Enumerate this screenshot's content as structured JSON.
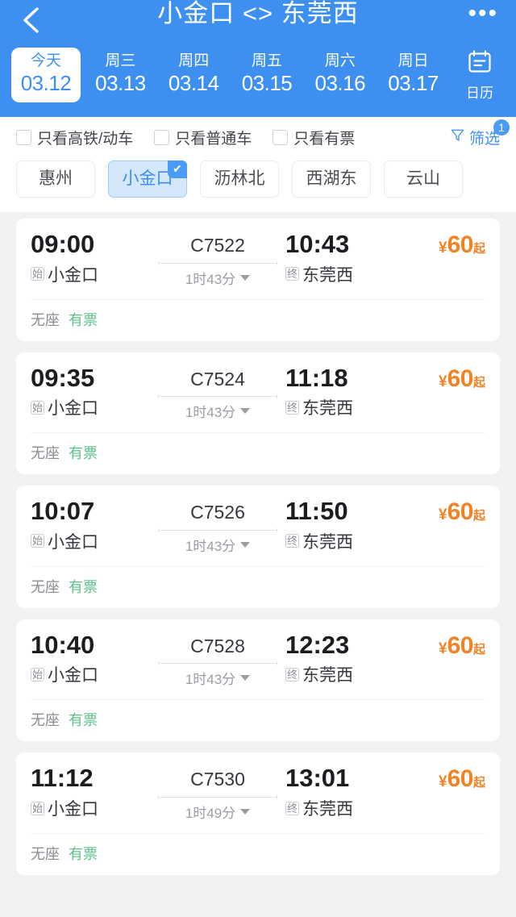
{
  "header": {
    "title": "小金口 <> 东莞西",
    "back_icon": "chevron-left-icon",
    "more_icon": "more-horizontal-icon",
    "calendar": {
      "icon": "calendar-icon",
      "label": "日历"
    },
    "dates": [
      {
        "dow": "今天",
        "date": "03.12",
        "active": true
      },
      {
        "dow": "周三",
        "date": "03.13",
        "active": false
      },
      {
        "dow": "周四",
        "date": "03.14",
        "active": false
      },
      {
        "dow": "周五",
        "date": "03.15",
        "active": false
      },
      {
        "dow": "周六",
        "date": "03.16",
        "active": false
      },
      {
        "dow": "周日",
        "date": "03.17",
        "active": false
      }
    ]
  },
  "filters": {
    "checkboxes": [
      {
        "label": "只看高铁/动车",
        "checked": false
      },
      {
        "label": "只看普通车",
        "checked": false
      },
      {
        "label": "只看有票",
        "checked": false
      }
    ],
    "filter_button": {
      "label": "筛选",
      "icon": "funnel-icon",
      "badge": "1"
    },
    "stations": [
      {
        "label": "惠州",
        "selected": false
      },
      {
        "label": "小金口",
        "selected": true,
        "tick": "✔"
      },
      {
        "label": "沥林北",
        "selected": false
      },
      {
        "label": "西湖东",
        "selected": false
      },
      {
        "label": "云山",
        "selected": false
      }
    ]
  },
  "trains": [
    {
      "depart_time": "09:00",
      "depart_tag": "始",
      "depart_station": "小金口",
      "train_no": "C7522",
      "duration": "1时43分",
      "arrive_time": "10:43",
      "arrive_tag": "终",
      "arrive_station": "东莞西",
      "price_currency": "¥",
      "price_amount": "60",
      "price_suffix": "起",
      "seat_class": "无座",
      "seat_status": "有票"
    },
    {
      "depart_time": "09:35",
      "depart_tag": "始",
      "depart_station": "小金口",
      "train_no": "C7524",
      "duration": "1时43分",
      "arrive_time": "11:18",
      "arrive_tag": "终",
      "arrive_station": "东莞西",
      "price_currency": "¥",
      "price_amount": "60",
      "price_suffix": "起",
      "seat_class": "无座",
      "seat_status": "有票"
    },
    {
      "depart_time": "10:07",
      "depart_tag": "始",
      "depart_station": "小金口",
      "train_no": "C7526",
      "duration": "1时43分",
      "arrive_time": "11:50",
      "arrive_tag": "终",
      "arrive_station": "东莞西",
      "price_currency": "¥",
      "price_amount": "60",
      "price_suffix": "起",
      "seat_class": "无座",
      "seat_status": "有票"
    },
    {
      "depart_time": "10:40",
      "depart_tag": "始",
      "depart_station": "小金口",
      "train_no": "C7528",
      "duration": "1时43分",
      "arrive_time": "12:23",
      "arrive_tag": "终",
      "arrive_station": "东莞西",
      "price_currency": "¥",
      "price_amount": "60",
      "price_suffix": "起",
      "seat_class": "无座",
      "seat_status": "有票"
    },
    {
      "depart_time": "11:12",
      "depart_tag": "始",
      "depart_station": "小金口",
      "train_no": "C7530",
      "duration": "1时49分",
      "arrive_time": "13:01",
      "arrive_tag": "终",
      "arrive_station": "东莞西",
      "price_currency": "¥",
      "price_amount": "60",
      "price_suffix": "起",
      "seat_class": "无座",
      "seat_status": "有票"
    }
  ],
  "colors": {
    "brand_blue": "#3d90f0",
    "price_orange": "#f08326",
    "available_green": "#5cc08a",
    "page_bg": "#f2f2f4"
  }
}
